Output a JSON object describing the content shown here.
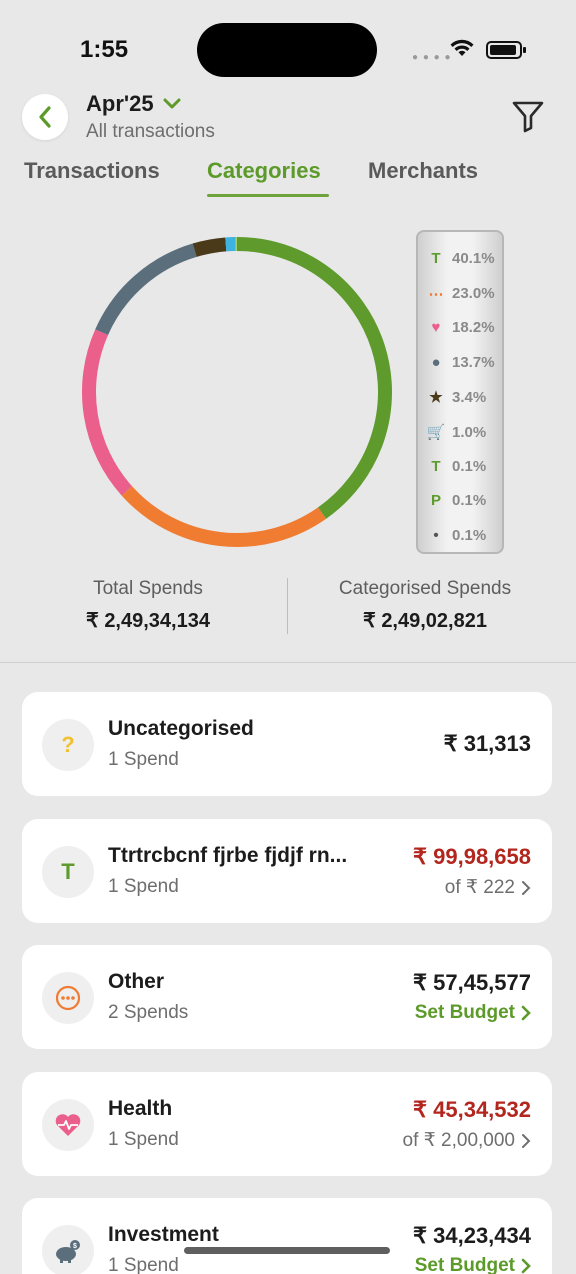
{
  "status": {
    "time": "1:55"
  },
  "header": {
    "period": "Apr'25",
    "subtitle": "All transactions"
  },
  "tabs": [
    {
      "label": "Transactions",
      "active": false
    },
    {
      "label": "Categories",
      "active": true
    },
    {
      "label": "Merchants",
      "active": false
    }
  ],
  "donut": {
    "segments": [
      {
        "value": 40.1,
        "color": "#5f9b2c"
      },
      {
        "value": 23.0,
        "color": "#f07c32"
      },
      {
        "value": 18.2,
        "color": "#ea5f8b"
      },
      {
        "value": 13.7,
        "color": "#5a6e7c"
      },
      {
        "value": 3.4,
        "color": "#4a3a1a"
      },
      {
        "value": 1.0,
        "color": "#3fb3e0"
      },
      {
        "value": 0.1,
        "color": "#8bbf5a"
      },
      {
        "value": 0.1,
        "color": "#9acb6a"
      }
    ]
  },
  "legend": [
    {
      "icon": "T",
      "icon_name": "letter-t-icon",
      "color": "#5f9b2c",
      "pct": "40.1%"
    },
    {
      "icon": "⋯",
      "icon_name": "more-dots-icon",
      "color": "#f07c32",
      "pct": "23.0%"
    },
    {
      "icon": "♥",
      "icon_name": "heart-icon",
      "color": "#ea5f8b",
      "pct": "18.2%"
    },
    {
      "icon": "●",
      "icon_name": "piggy-bank-icon",
      "color": "#5a6e7c",
      "pct": "13.7%"
    },
    {
      "icon": "★",
      "icon_name": "stars-icon",
      "color": "#4a3a1a",
      "pct": "3.4%"
    },
    {
      "icon": "🛒",
      "icon_name": "cart-icon",
      "color": "#3fb3e0",
      "pct": "1.0%"
    },
    {
      "icon": "T",
      "icon_name": "letter-t-icon",
      "color": "#5f9b2c",
      "pct": "0.1%"
    },
    {
      "icon": "P",
      "icon_name": "letter-p-icon",
      "color": "#5f9b2c",
      "pct": "0.1%"
    },
    {
      "icon": "•",
      "icon_name": "small-icon",
      "color": "#555555",
      "pct": "0.1%"
    }
  ],
  "summary": {
    "total_label": "Total Spends",
    "total_value": "₹ 2,49,34,134",
    "categorised_label": "Categorised Spends",
    "categorised_value": "₹ 2,49,02,821"
  },
  "categories": [
    {
      "name": "Uncategorised",
      "count": "1 Spend",
      "amount": "₹ 31,313",
      "sub": "",
      "icon": "?",
      "icon_name": "question-icon",
      "icon_color": "#f2c12e",
      "over": false
    },
    {
      "name": "Ttrtrcbcnf fjrbe fjdjf rn...",
      "count": "1 Spend",
      "amount": "₹ 99,98,658",
      "sub": "of ₹ 222",
      "icon": "T",
      "icon_name": "letter-t-icon",
      "icon_color": "#5f9b2c",
      "over": true
    },
    {
      "name": "Other",
      "count": "2 Spends",
      "amount": "₹ 57,45,577",
      "sub": "Set Budget",
      "icon": "⋯",
      "icon_name": "more-dots-icon",
      "icon_color": "#f07c32",
      "over": false
    },
    {
      "name": "Health",
      "count": "1 Spend",
      "amount": "₹ 45,34,532",
      "sub": "of ₹ 2,00,000",
      "icon": "♥",
      "icon_name": "heart-pulse-icon",
      "icon_color": "#ea5f8b",
      "over": true
    },
    {
      "name": "Investment",
      "count": "1 Spend",
      "amount": "₹ 34,23,434",
      "sub": "Set Budget",
      "icon": "●",
      "icon_name": "piggy-bank-icon",
      "icon_color": "#5a6e7c",
      "over": false
    }
  ]
}
